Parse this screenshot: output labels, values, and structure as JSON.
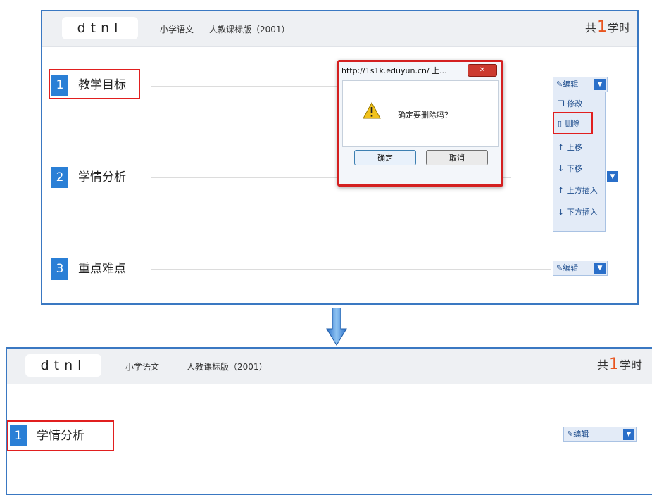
{
  "top": {
    "logo": "dtnl",
    "subject": "小学语文",
    "edition": "人教课标版（2001）",
    "hours_prefix": "共",
    "hours_count": "1",
    "hours_suffix": "学时",
    "rows": [
      {
        "num": "1",
        "title": "教学目标"
      },
      {
        "num": "2",
        "title": "学情分析"
      },
      {
        "num": "3",
        "title": "重点难点"
      }
    ],
    "edit_label": "编辑",
    "menu": {
      "edit": "编辑",
      "modify": "修改",
      "delete": "删除",
      "move_up": "上移",
      "move_down": "下移",
      "insert_above": "上方插入",
      "insert_below": "下方插入"
    },
    "dialog": {
      "title": "http://1s1k.eduyun.cn/ 上...",
      "message": "确定要删除吗？",
      "ok": "确定",
      "cancel": "取消"
    }
  },
  "bottom": {
    "logo": "dtnl",
    "subject": "小学语文",
    "edition": "人教课标版（2001）",
    "hours_prefix": "共",
    "hours_count": "1",
    "hours_suffix": "学时",
    "rows": [
      {
        "num": "1",
        "title": "学情分析"
      }
    ],
    "edit_label": "编辑"
  },
  "icons": {
    "dropdown": "chevron-down-icon",
    "edit": "pencil-icon",
    "modify": "copy-icon",
    "delete": "trash-icon",
    "up": "arrow-up-icon",
    "down": "arrow-down-icon",
    "warning": "warning-icon",
    "close": "close-icon",
    "flow": "flow-down-arrow-icon"
  },
  "colors": {
    "panel_border": "#3a78c2",
    "number_badge": "#2a7fd6",
    "highlight": "#e11f1f",
    "hours_accent": "#e8541e"
  }
}
